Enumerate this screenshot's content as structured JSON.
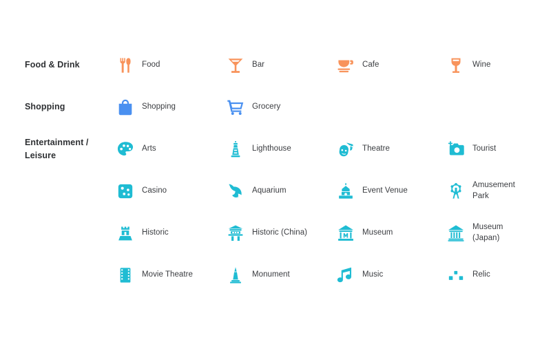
{
  "palette": {
    "orange": "#F8935B",
    "blue": "#4A90F0",
    "teal": "#1FBCD3",
    "text": "#3a3c40",
    "heading": "#2e3033",
    "background": "#ffffff"
  },
  "rows": [
    {
      "category": "Food & Drink",
      "items": [
        {
          "label": "Food",
          "icon": "food-icon",
          "color": "#F8935B"
        },
        {
          "label": "Bar",
          "icon": "bar-icon",
          "color": "#F8935B"
        },
        {
          "label": "Cafe",
          "icon": "cafe-icon",
          "color": "#F8935B"
        },
        {
          "label": "Wine",
          "icon": "wine-icon",
          "color": "#F8935B"
        }
      ]
    },
    {
      "category": "Shopping",
      "items": [
        {
          "label": "Shopping",
          "icon": "shopping-bag-icon",
          "color": "#4A90F0"
        },
        {
          "label": "Grocery",
          "icon": "shopping-cart-icon",
          "color": "#4A90F0"
        }
      ]
    },
    {
      "category": "Entertainment /\nLeisure",
      "items": [
        {
          "label": "Arts",
          "icon": "palette-icon",
          "color": "#1FBCD3"
        },
        {
          "label": "Lighthouse",
          "icon": "lighthouse-icon",
          "color": "#1FBCD3"
        },
        {
          "label": "Theatre",
          "icon": "theatre-masks-icon",
          "color": "#1FBCD3"
        },
        {
          "label": "Tourist",
          "icon": "camera-icon",
          "color": "#1FBCD3"
        }
      ]
    },
    {
      "category": "",
      "items": [
        {
          "label": "Casino",
          "icon": "dice-icon",
          "color": "#1FBCD3"
        },
        {
          "label": "Aquarium",
          "icon": "dolphin-icon",
          "color": "#1FBCD3"
        },
        {
          "label": "Event Venue",
          "icon": "event-venue-icon",
          "color": "#1FBCD3"
        },
        {
          "label": "Amusement\nPark",
          "icon": "ferris-wheel-icon",
          "color": "#1FBCD3"
        }
      ]
    },
    {
      "category": "",
      "items": [
        {
          "label": "Historic",
          "icon": "castle-tower-icon",
          "color": "#1FBCD3"
        },
        {
          "label": "Historic (China)",
          "icon": "pagoda-gate-icon",
          "color": "#1FBCD3"
        },
        {
          "label": "Museum",
          "icon": "museum-icon",
          "color": "#1FBCD3"
        },
        {
          "label": "Museum\n(Japan)",
          "icon": "museum-japan-icon",
          "color": "#1FBCD3"
        }
      ]
    },
    {
      "category": "",
      "items": [
        {
          "label": "Movie Theatre",
          "icon": "film-strip-icon",
          "color": "#1FBCD3"
        },
        {
          "label": "Monument",
          "icon": "monument-icon",
          "color": "#1FBCD3"
        },
        {
          "label": "Music",
          "icon": "music-note-icon",
          "color": "#1FBCD3"
        },
        {
          "label": "Relic",
          "icon": "relic-icon",
          "color": "#1FBCD3"
        }
      ]
    }
  ],
  "layout": {
    "row_tops": [
      64,
      125,
      186,
      247,
      308,
      369
    ]
  }
}
